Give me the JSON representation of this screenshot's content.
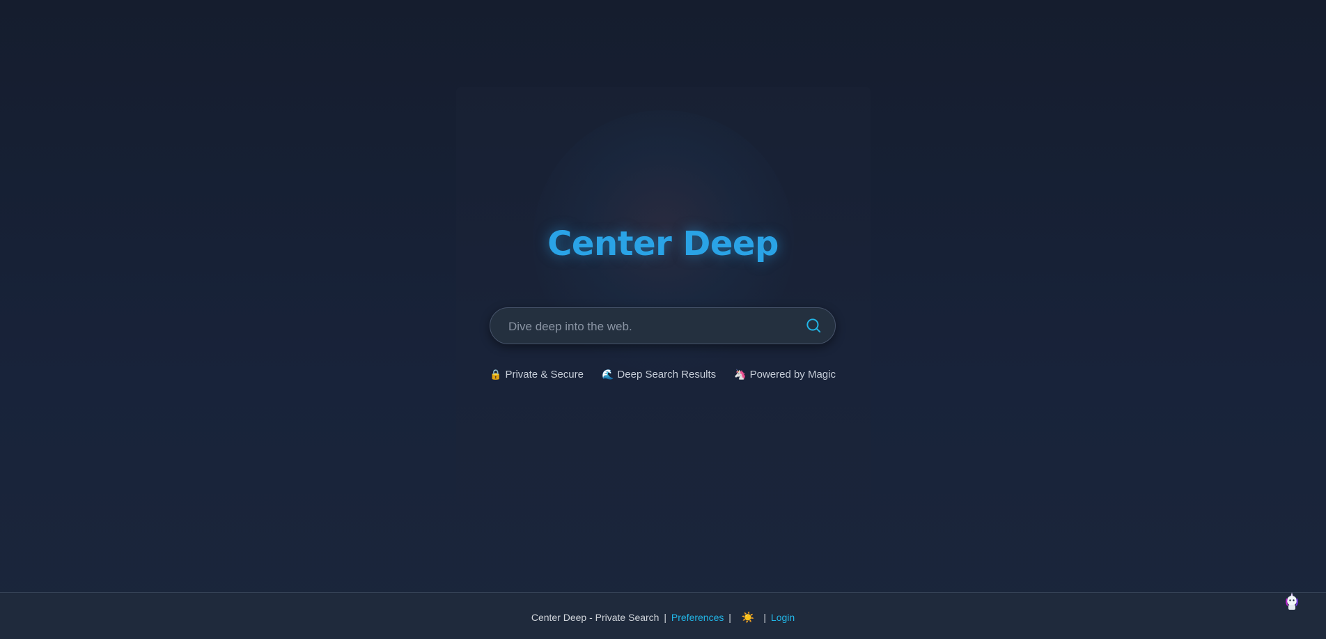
{
  "app": {
    "title": "Center Deep"
  },
  "search": {
    "placeholder": "Dive deep into the web.",
    "value": ""
  },
  "features": [
    {
      "icon": "🔒",
      "label": "Private & Secure"
    },
    {
      "icon": "🌊",
      "label": "Deep Search Results"
    },
    {
      "icon": "🦄",
      "label": "Powered by Magic"
    }
  ],
  "footer": {
    "brand_text": "Center Deep - Private Search",
    "separator": "|",
    "preferences_label": "Preferences",
    "theme_icon": "☀️",
    "login_label": "Login"
  },
  "colors": {
    "accent": "#22b7e8",
    "title": "#2aa3e6",
    "background": "#18233a"
  },
  "icons": {
    "search": "search-icon",
    "theme": "sun-icon",
    "mascot": "unicorn-mascot-icon"
  }
}
